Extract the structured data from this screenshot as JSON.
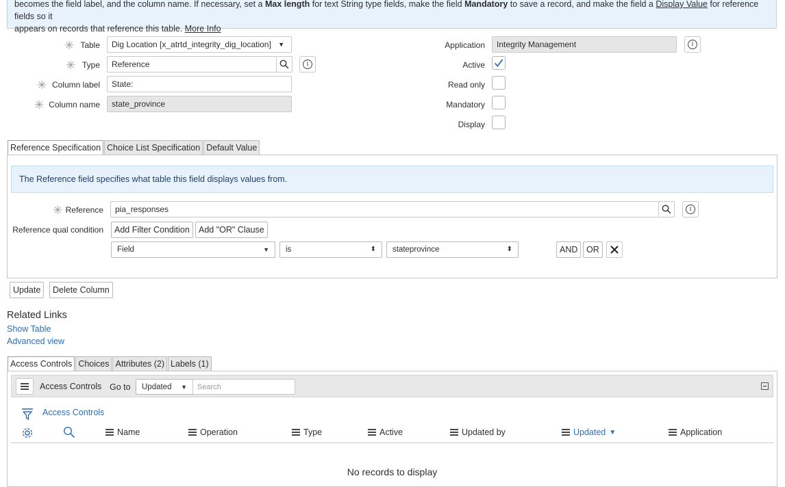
{
  "banner": {
    "line1_a": "becomes the field label, and the column name. If necessary, set a ",
    "line1_b": "Max length",
    "line1_c": " for text String type fields, make the field ",
    "line1_d": "Mandatory",
    "line1_e": " to save a record, and make the field a ",
    "line1_f": "Display Value",
    "line1_g": " for reference fields so it",
    "line2": "appears on records that reference this table. ",
    "more_info": "More Info"
  },
  "form": {
    "table_label": "Table",
    "table_value": "Dig Location [x_atrtd_integrity_dig_location]",
    "type_label": "Type",
    "type_value": "Reference",
    "column_label_label": "Column label",
    "column_label_value": "State:",
    "column_name_label": "Column name",
    "column_name_value": "state_province",
    "application_label": "Application",
    "application_value": "Integrity Management",
    "active_label": "Active",
    "read_only_label": "Read only",
    "mandatory_label": "Mandatory",
    "display_label": "Display"
  },
  "spec_tabs": [
    "Reference Specification",
    "Choice List Specification",
    "Default Value"
  ],
  "ref_panel": {
    "notice": "The Reference field specifies what table this field displays values from.",
    "reference_label": "Reference",
    "reference_value": "pia_responses",
    "qual_label": "Reference qual condition",
    "add_filter": "Add Filter Condition",
    "add_or": "Add \"OR\" Clause",
    "cond_field": "Field",
    "cond_operator": "is",
    "cond_value": "stateprovince",
    "and_label": "AND",
    "or_label": "OR"
  },
  "actions": {
    "update": "Update",
    "delete": "Delete Column"
  },
  "related": {
    "title": "Related Links",
    "show_table": "Show Table",
    "advanced_view": "Advanced view"
  },
  "list_tabs": [
    "Access Controls",
    "Choices",
    "Attributes (2)",
    "Labels (1)"
  ],
  "list": {
    "title": "Access Controls",
    "goto_label": "Go to",
    "goto_value": "Updated",
    "search_placeholder": "Search",
    "filter_link": "Access Controls",
    "columns": [
      "Name",
      "Operation",
      "Type",
      "Active",
      "Updated by",
      "Updated",
      "Application"
    ],
    "empty": "No records to display"
  },
  "colors": {
    "link": "#2d6eb2",
    "banner_bg": "#e8f2fc",
    "check": "#2d6eb2"
  }
}
